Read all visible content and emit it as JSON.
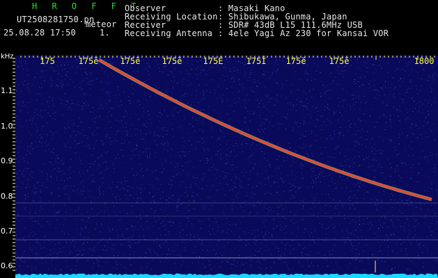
{
  "app": {
    "title": "H R O F F T"
  },
  "capture": {
    "filename": "UT2508281750.pn",
    "event_type": "meteor",
    "datetime": "25.08.28 17:50",
    "index": "1."
  },
  "info_labels": [
    "Observer",
    "Receiving Location",
    "Receiver",
    "Receiving Antenna"
  ],
  "info_values": [
    ": Masaki Kano",
    ": Shibukawa, Gunma, Japan",
    ": SDR# 43dB L15 111.6MHz USB",
    ": 4ele Yagi Az 230 for Kansai VOR"
  ],
  "axis": {
    "unit": "kHz",
    "freq_ticks": [
      "1.1",
      "1.0",
      "0.9",
      "0.8",
      "0.7",
      "0.6"
    ],
    "time_ticks": [
      "175",
      "175ĕ",
      "175ĕ",
      "175ĕ",
      "175Ė",
      "175Ī",
      "175ĕ",
      "175ĕ",
      "1800"
    ]
  },
  "colors": {
    "background": "#000000",
    "spectrogram_bg": "#0a0a5a",
    "noise": "#3a5fe0",
    "trace_core": "#ff3a2a",
    "trace_halo": "#f0e060",
    "baseline": "#19d9ff",
    "tick_label": "#ffff40",
    "freq_label": "#ffffff",
    "title": "#33dd33"
  }
}
